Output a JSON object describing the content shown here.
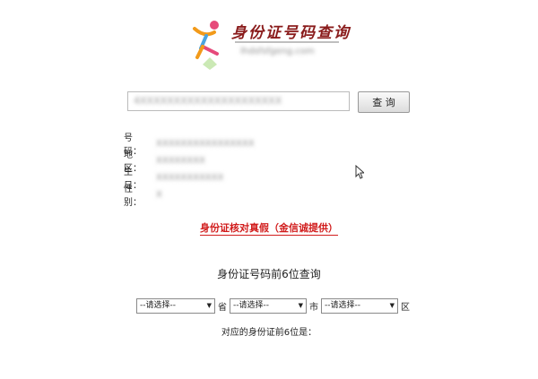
{
  "header": {
    "brand_title": "身份证号码查询",
    "brand_sub": "lhdsfsfgeng.com"
  },
  "search": {
    "input_value": "4XXXXXXXXXXXXXXXXXXXXX",
    "button_label": "查 询"
  },
  "info": {
    "rows": [
      {
        "label": "号 码：",
        "value": "XXXXXXXXXXXXXXXX"
      },
      {
        "label": "地 区：",
        "value": "XXXXXXXX"
      },
      {
        "label": "生 日：",
        "value": "XXXXXXXXXXX"
      },
      {
        "label": "性 别：",
        "value": "X"
      }
    ]
  },
  "verify_link": "身份证核对真假（金信诚提供）",
  "prefix_query": {
    "title": "身份证号码前6位查询",
    "province": {
      "selected": "--请选择--",
      "unit": "省"
    },
    "city": {
      "selected": "--请选择--",
      "unit": "市"
    },
    "district": {
      "selected": "--请选择--",
      "unit": "区"
    },
    "result_label": "对应的身份证前6位是："
  }
}
